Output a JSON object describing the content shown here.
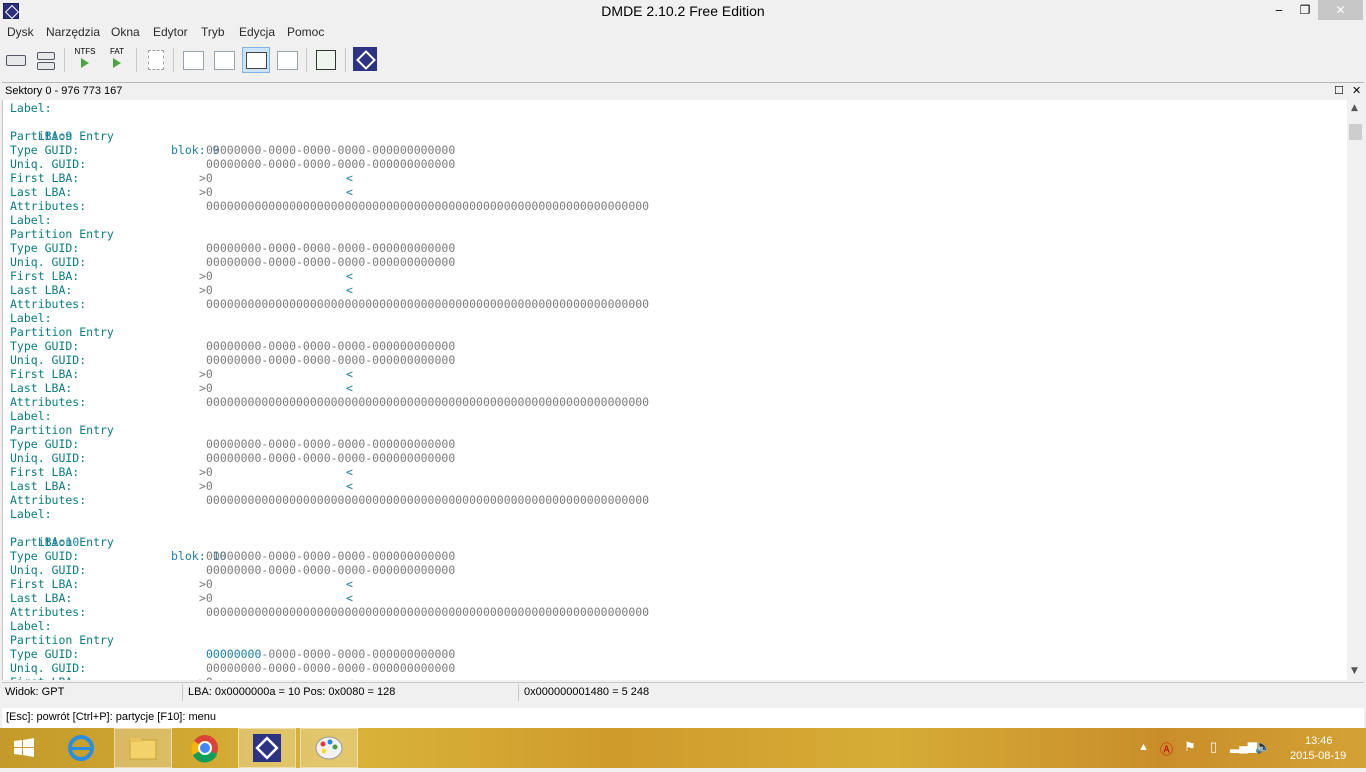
{
  "window": {
    "title": "DMDE 2.10.2 Free Edition",
    "minimize": "‒",
    "maximize": "❐",
    "close": "✕"
  },
  "menu": [
    "Dysk",
    "Narzędzia",
    "Okna",
    "Edytor",
    "Tryb",
    "Edycja",
    "Pomoc"
  ],
  "toolbar": {
    "ntfs_label": "NTFS",
    "fat_label": "FAT"
  },
  "panel": {
    "title": "Sektory 0 - 976 773 167",
    "maximize": "☐",
    "close": "✕"
  },
  "fields": {
    "label": "Label:",
    "partition_entry": "Partition Entry",
    "type_guid": "Type GUID:",
    "uniq_guid": "Uniq. GUID:",
    "first_lba": "First LBA:",
    "last_lba": "Last LBA:",
    "attributes": "Attributes:",
    "guid_value": "00000000-0000-0000-0000-000000000000",
    "guid_value_head": "00000000",
    "guid_value_tail": "-0000-0000-0000-000000000000",
    "lba_value": ">0",
    "lba_end": "<",
    "attr_value": "0000000000000000000000000000000000000000000000000000000000000000"
  },
  "blocks": [
    {
      "lba": "LBA:9",
      "blok": "blok: 9"
    },
    {
      "lba": "LBA:10",
      "blok": "blok: 10"
    }
  ],
  "status": {
    "view": "Widok: GPT",
    "lba": "LBA: 0x0000000a = 10  Pos: 0x0080 = 128",
    "offset": "0x000000001480 = 5 248"
  },
  "hint": "[Esc]: powrót  [Ctrl+P]: partycje  [F10]: menu",
  "tray": {
    "time": "13:46",
    "date": "2015-08-19"
  },
  "colors": {
    "label_teal": "#0a7d7d",
    "lba_blue": "#1c7ea8",
    "value_gray": "#7c7c7c"
  }
}
